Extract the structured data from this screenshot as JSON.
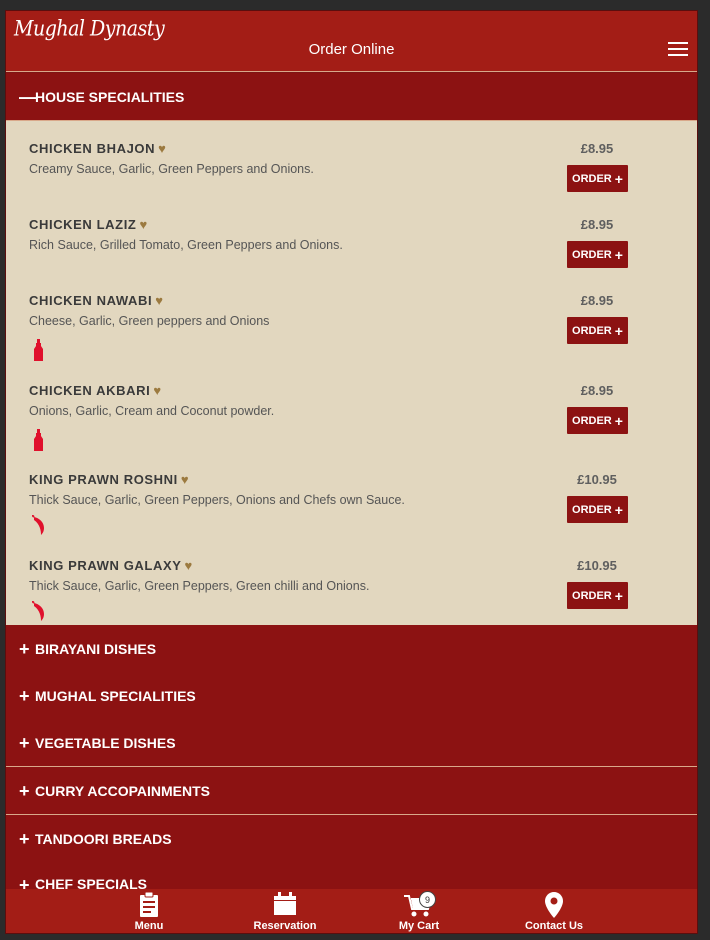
{
  "header": {
    "logo_text": "Mughal Dynasty",
    "title": "Order Online",
    "menu_icon": "hamburger-icon"
  },
  "open_section": {
    "symbol": "—",
    "label": "HOUSE SPECIALITIES",
    "items": [
      {
        "name": "CHICKEN BHAJON",
        "desc": "Creamy Sauce, Garlic, Green Peppers and Onions.",
        "price": "£8.95",
        "order_label": "ORDER",
        "icon": ""
      },
      {
        "name": "CHICKEN LAZIZ",
        "desc": "Rich Sauce, Grilled Tomato, Green Peppers and Onions.",
        "price": "£8.95",
        "order_label": "ORDER",
        "icon": ""
      },
      {
        "name": "CHICKEN NAWABI",
        "desc": "Cheese, Garlic, Green peppers and Onions",
        "price": "£8.95",
        "order_label": "ORDER",
        "icon": "hot-sauce-bottle-icon"
      },
      {
        "name": "CHICKEN AKBARI",
        "desc": "Onions, Garlic, Cream and Coconut powder.",
        "price": "£8.95",
        "order_label": "ORDER",
        "icon": "hot-sauce-bottle-icon"
      },
      {
        "name": "KING PRAWN ROSHNI",
        "desc": "Thick Sauce, Garlic, Green Peppers, Onions and Chefs own Sauce.",
        "price": "£10.95",
        "order_label": "ORDER",
        "icon": "chilli-icon"
      },
      {
        "name": "KING PRAWN GALAXY",
        "desc": "Thick Sauce, Garlic, Green Peppers, Green chilli and Onions.",
        "price": "£10.95",
        "order_label": "ORDER",
        "icon": "chilli-icon"
      }
    ]
  },
  "closed_sections": [
    {
      "symbol": "+",
      "label": "BIRAYANI DISHES"
    },
    {
      "symbol": "+",
      "label": "MUGHAL SPECIALITIES"
    },
    {
      "symbol": "+",
      "label": "VEGETABLE DISHES"
    },
    {
      "symbol": "+",
      "label": "CURRY ACCOPAINMENTS"
    },
    {
      "symbol": "+",
      "label": "TANDOORI BREADS"
    },
    {
      "symbol": "+",
      "label": "CHEF SPECIALS"
    }
  ],
  "footer": {
    "menu": {
      "label": "Menu",
      "icon": "clipboard-icon"
    },
    "reservation": {
      "label": "Reservation",
      "icon": "calendar-icon"
    },
    "cart": {
      "label": "My Cart",
      "icon": "cart-icon",
      "count": "9"
    },
    "contact": {
      "label": "Contact Us",
      "icon": "map-pin-icon"
    }
  },
  "colors": {
    "header_red": "#a31d16",
    "section_red": "#8c1212",
    "panel_beige": "#e2d7bf",
    "heart_gold": "#9c7a3f",
    "icon_red": "#e0102c"
  }
}
